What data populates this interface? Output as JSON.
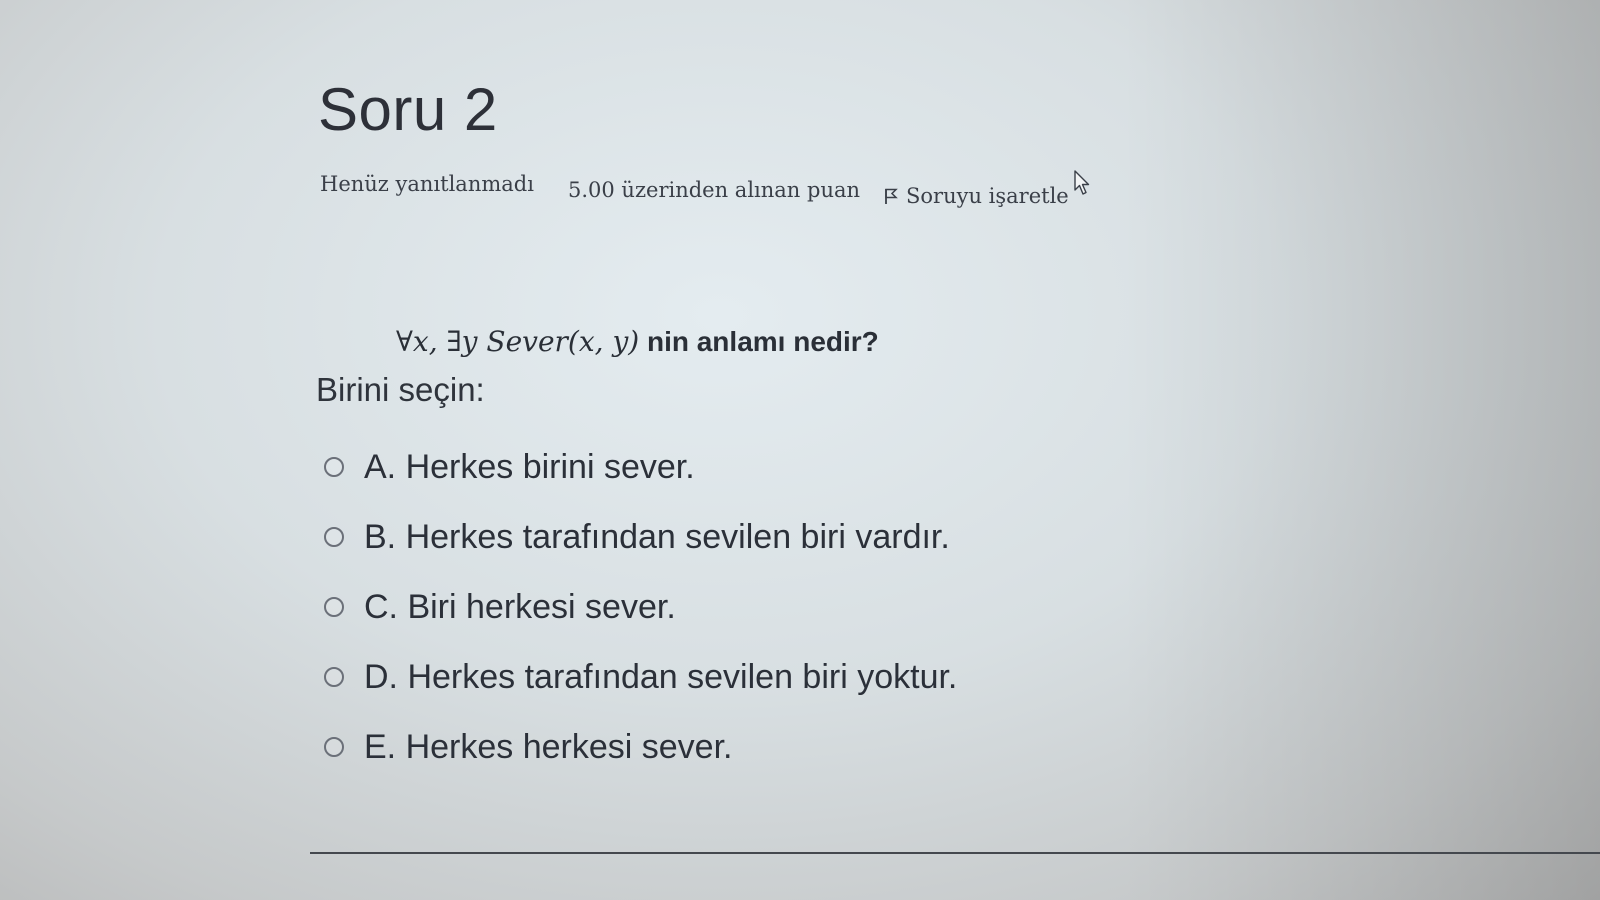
{
  "question": {
    "title": "Soru 2",
    "state": "Henüz yanıtlanmadı",
    "grade": "5.00 üzerinden alınan puan",
    "flag_label": "Soruyu işaretle",
    "formula": "∀x, ∃y Sever(x, y)",
    "text_suffix": " nin anlamı nedir?",
    "prompt": "Birini seçin:",
    "options": [
      {
        "label": "A. Herkes birini sever."
      },
      {
        "label": "B. Herkes tarafından sevilen biri vardır."
      },
      {
        "label": "C. Biri herkesi sever."
      },
      {
        "label": "D. Herkes tarafından sevilen biri yoktur."
      },
      {
        "label": "E. Herkes herkesi sever."
      }
    ]
  },
  "icons": {
    "flag": "flag-icon",
    "cursor": "mouse-pointer-icon",
    "radio": "radio-unchecked-icon"
  }
}
